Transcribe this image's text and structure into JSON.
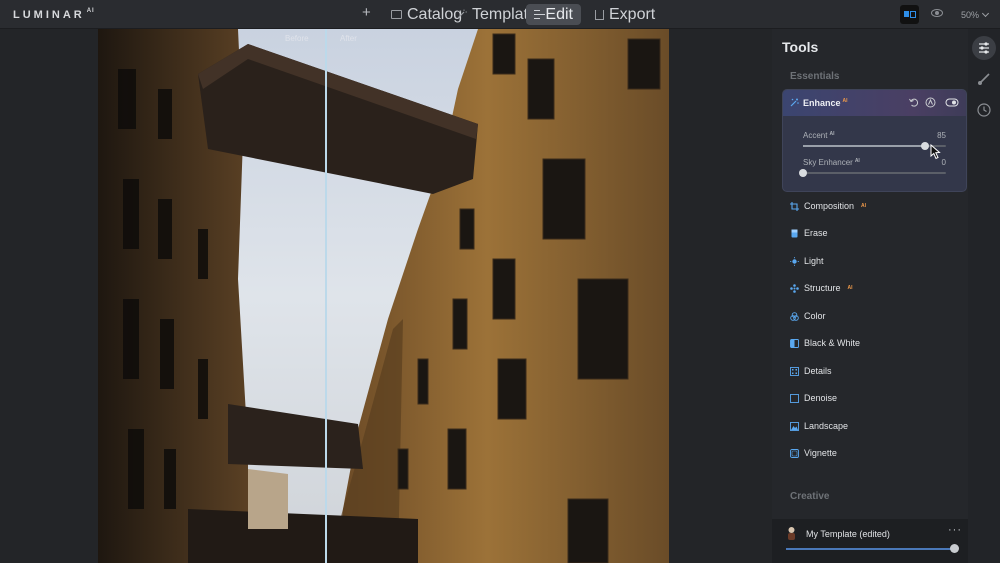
{
  "app": {
    "logo": "LUMINAR",
    "logo_suffix": "AI"
  },
  "nav": {
    "add_symbol": "+",
    "catalog_label": "Catalog",
    "templates_label": "Templates",
    "edit_label": "Edit",
    "export_label": "Export"
  },
  "view": {
    "zoom_label": "50%"
  },
  "canvas": {
    "before_label": "Before",
    "after_label": "After"
  },
  "panel": {
    "title": "Tools",
    "essentials_label": "Essentials",
    "creative_label": "Creative",
    "enhance": {
      "name": "Enhance",
      "ai_tag": "AI",
      "sliders": [
        {
          "label": "Accent",
          "ai_tag": "AI",
          "value": 85
        },
        {
          "label": "Sky Enhancer",
          "ai_tag": "AI",
          "value": 0
        }
      ]
    },
    "tools": [
      {
        "label": "Composition",
        "ai": "AI"
      },
      {
        "label": "Erase",
        "ai": ""
      },
      {
        "label": "Light",
        "ai": ""
      },
      {
        "label": "Structure",
        "ai": "AI"
      },
      {
        "label": "Color",
        "ai": ""
      },
      {
        "label": "Black & White",
        "ai": ""
      },
      {
        "label": "Details",
        "ai": ""
      },
      {
        "label": "Denoise",
        "ai": ""
      },
      {
        "label": "Landscape",
        "ai": ""
      },
      {
        "label": "Vignette",
        "ai": ""
      }
    ],
    "template": {
      "name": "My Template (edited)",
      "more": "···",
      "amount": 100
    }
  },
  "colors": {
    "accent_blue": "#2e8ee8",
    "ai_orange": "#f09a4a",
    "tool_icon_blue": "#5aa8f0"
  }
}
